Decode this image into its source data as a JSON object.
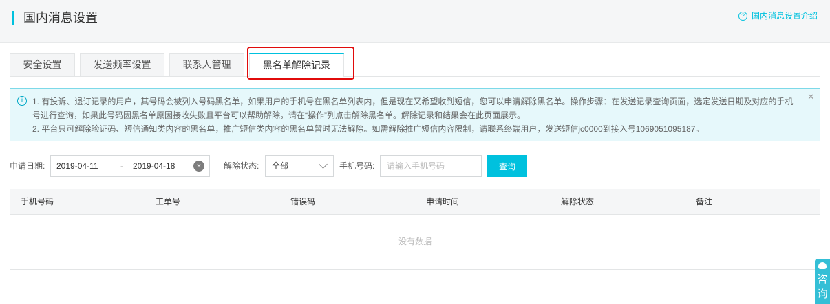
{
  "header": {
    "title": "国内消息设置",
    "help_link": "国内消息设置介绍"
  },
  "tabs": [
    {
      "label": "安全设置",
      "active": false
    },
    {
      "label": "发送频率设置",
      "active": false
    },
    {
      "label": "联系人管理",
      "active": false
    },
    {
      "label": "黑名单解除记录",
      "active": true
    }
  ],
  "notice": {
    "lines": [
      "1. 有投诉、退订记录的用户，其号码会被列入号码黑名单，如果用户的手机号在黑名单列表内，但是现在又希望收到短信，您可以申请解除黑名单。操作步骤：在发送记录查询页面，选定发送日期及对应的手机",
      "号进行查询，如果此号码因黑名单原因接收失败且平台可以帮助解除，请在“操作”列点击解除黑名单。解除记录和结果会在此页面展示。",
      "2. 平台只可解除验证码、短信通知类内容的黑名单，推广短信类内容的黑名单暂时无法解除。如需解除推广短信内容限制，请联系终端用户，发送短信jc0000到接入号1069051095187。"
    ]
  },
  "filters": {
    "date_label": "申请日期:",
    "date_start": "2019-04-11",
    "date_sep": "-",
    "date_end": "2019-04-18",
    "status_label": "解除状态:",
    "status_value": "全部",
    "phone_label": "手机号码:",
    "phone_placeholder": "请输入手机号码",
    "query_label": "查询"
  },
  "table": {
    "columns": [
      "手机号码",
      "工单号",
      "错误码",
      "申请时间",
      "解除状态",
      "备注"
    ],
    "empty_text": "没有数据"
  },
  "consult": {
    "label": "咨询"
  },
  "colors": {
    "accent": "#00c1de",
    "highlight": "#e10b0b"
  }
}
